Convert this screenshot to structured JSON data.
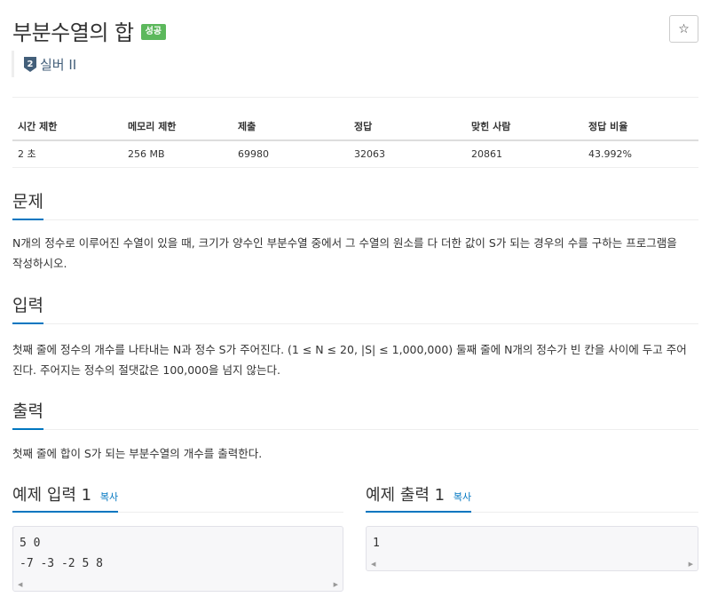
{
  "header": {
    "title": "부분수열의 합",
    "badge": "성공",
    "star_symbol": "☆"
  },
  "tier": {
    "number": "2",
    "label": "실버 II"
  },
  "info_table": {
    "headers": [
      "시간 제한",
      "메모리 제한",
      "제출",
      "정답",
      "맞힌 사람",
      "정답 비율"
    ],
    "values": [
      "2 초",
      "256 MB",
      "69980",
      "32063",
      "20861",
      "43.992%"
    ]
  },
  "problem": {
    "heading": "문제",
    "lines": [
      "N개의 정수로 이루어진 수열이 있을 때, 크기가 양수인 부분수열 중에서 그 수열의 원소를 다 더한 값이 S가 되는 경우의 수를 구하는 프로그램을",
      "작성하시오."
    ]
  },
  "input": {
    "heading": "입력",
    "lines": [
      "첫째 줄에 정수의 개수를 나타내는 N과 정수 S가 주어진다. (1 ≤ N ≤ 20, |S| ≤ 1,000,000) 둘째 줄에 N개의 정수가 빈 칸을 사이에 두고 주어",
      "진다. 주어지는 정수의 절댓값은 100,000을 넘지 않는다."
    ]
  },
  "output": {
    "heading": "출력",
    "lines": [
      "첫째 줄에 합이 S가 되는 부분수열의 개수를 출력한다."
    ]
  },
  "sample_input": {
    "heading": "예제 입력 1",
    "copy": "복사",
    "lines": [
      "5 0",
      "-7 -3 -2 5 8"
    ]
  },
  "sample_output": {
    "heading": "예제 출력 1",
    "copy": "복사",
    "lines": [
      "1"
    ]
  },
  "colors": {
    "accent": "#0076c0",
    "badge_green": "#5cb85c",
    "tier_silver": "#435f7a"
  },
  "icons": {
    "star": "star-icon",
    "tier": "tier-badge-icon",
    "scroll_left": "scroll-left-icon",
    "scroll_right": "scroll-right-icon"
  }
}
